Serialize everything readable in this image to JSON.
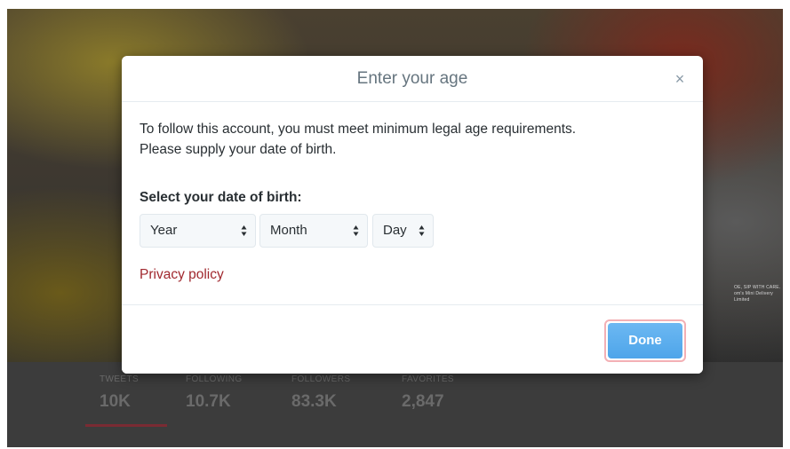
{
  "background": {
    "banner_tag_lines": [
      "OE, SIP WITH CARE.",
      "om's Mini Delivery Limited"
    ],
    "stats": [
      {
        "label": "TWEETS",
        "value": "10K"
      },
      {
        "label": "FOLLOWING",
        "value": "10.7K"
      },
      {
        "label": "FOLLOWERS",
        "value": "83.3K"
      },
      {
        "label": "FAVORITES",
        "value": "2,847"
      }
    ],
    "active_tab_color": "#7a2b33"
  },
  "modal": {
    "title": "Enter your age",
    "close_glyph": "×",
    "intro_line1": "To follow this account, you must meet minimum legal age requirements.",
    "intro_line2": "Please supply your date of birth.",
    "dob_label": "Select your date of birth:",
    "selects": {
      "year": "Year",
      "month": "Month",
      "day": "Day"
    },
    "privacy_link": "Privacy policy",
    "done_label": "Done"
  },
  "colors": {
    "accent": "#55acee",
    "link": "#a0282e",
    "focus_ring": "#f3b0b5"
  },
  "icons": {
    "close": "close-icon",
    "select_arrows": "updown-arrows-icon"
  }
}
